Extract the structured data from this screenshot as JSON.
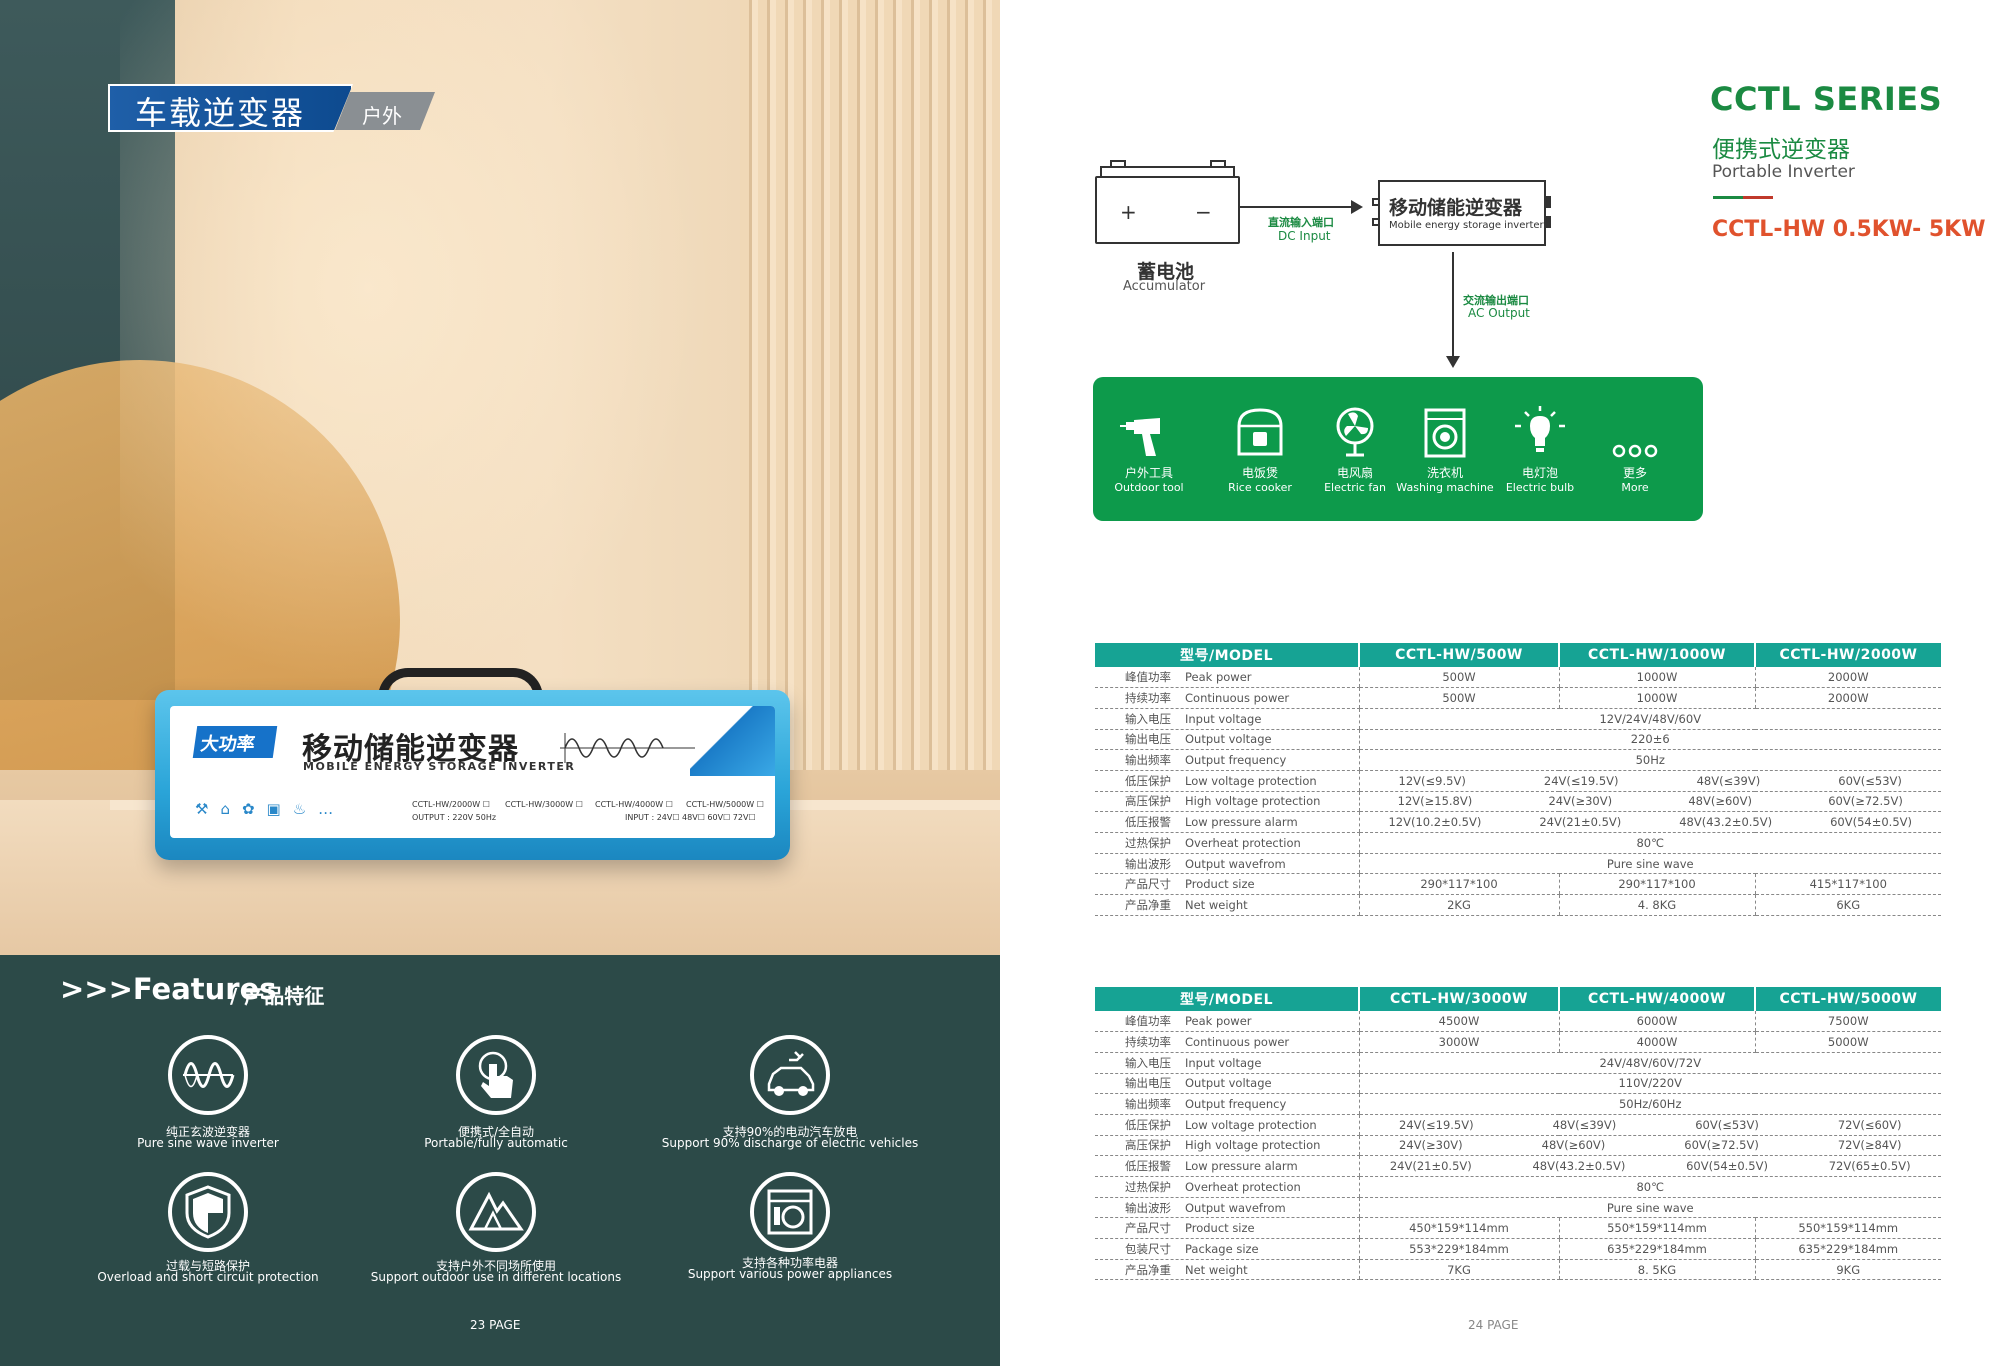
{
  "left": {
    "banner": {
      "title": "车载逆变器",
      "tag": "户外"
    },
    "product": {
      "logo": "大功率",
      "name": "移动储能逆变器",
      "sub": "MOBILE ENERGY STORAGE INVERTER",
      "models": [
        "CCTL-HW/2000W ☐",
        "OUTPUT : 220V 50Hz",
        "CCTL-HW/3000W ☐",
        "CCTL-HW/4000W ☐",
        "INPUT : 24V☐ 48V☐ 60V☐ 72V☐",
        "CCTL-HW/5000W ☐"
      ]
    },
    "features": {
      "title": ">>>Features",
      "title_cn": "/ 产品特征",
      "items": [
        {
          "cn": "纯正玄波逆变器",
          "en": "Pure sine wave inverter",
          "icon": "sine-wave-icon"
        },
        {
          "cn": "便携式/全自动",
          "en": "Portable/fully automatic",
          "icon": "touch-hand-icon"
        },
        {
          "cn": "支持90%的电动汽车放电",
          "en": "Support 90% discharge of electric vehicles",
          "icon": "electric-car-icon"
        },
        {
          "cn": "过载与短路保护",
          "en": "Overload and short circuit protection",
          "icon": "shield-icon"
        },
        {
          "cn": "支持户外不同场所使用",
          "en": "Support outdoor use in different locations",
          "icon": "mountain-icon"
        },
        {
          "cn": "支持各种功率电器",
          "en": "Support various power appliances",
          "icon": "appliance-icon"
        }
      ]
    },
    "page": "23 PAGE"
  },
  "right": {
    "series": "CCTL SERIES",
    "series_cn": "便携式逆变器",
    "series_en": "Portable Inverter",
    "model_range": "CCTL-HW 0.5KW- 5KW",
    "diagram": {
      "battery_cn": "蓄电池",
      "battery_en": "Accumulator",
      "dc_cn": "直流输入端口",
      "dc_en": "DC Input",
      "inverter_cn": "移动储能逆变器",
      "inverter_en": "Mobile energy storage inverter",
      "ac_cn": "交流输出端口",
      "ac_en": "AC Output",
      "apps": [
        {
          "cn": "户外工具",
          "en": "Outdoor tool",
          "icon": "drill-icon"
        },
        {
          "cn": "电饭煲",
          "en": "Rice cooker",
          "icon": "rice-cooker-icon"
        },
        {
          "cn": "电风扇",
          "en": "Electric fan",
          "icon": "fan-icon"
        },
        {
          "cn": "洗衣机",
          "en": "Washing machine",
          "icon": "washing-machine-icon"
        },
        {
          "cn": "电灯泡",
          "en": "Electric bulb",
          "icon": "bulb-icon"
        },
        {
          "cn": "更多",
          "en": "More",
          "icon": "more-icon"
        }
      ]
    },
    "table1": {
      "headers": [
        "型号/MODEL",
        "CCTL-HW/500W",
        "CCTL-HW/1000W",
        "CCTL-HW/2000W"
      ],
      "rows": {
        "peak": [
          "峰值功率",
          "Peak power",
          "500W",
          "1000W",
          "2000W"
        ],
        "cont": [
          "持续功率",
          "Continuous power",
          "500W",
          "1000W",
          "2000W"
        ],
        "input": [
          "输入电压",
          "Input voltage",
          "12V/24V/48V/60V"
        ],
        "output": [
          "输出电压",
          "Output voltage",
          "220±6"
        ],
        "freq": [
          "输出频率",
          "Output frequency",
          "50Hz"
        ],
        "lowv": [
          "低压保护",
          "Low voltage protection",
          "12V(≤9.5V)",
          "24V(≤19.5V)",
          "48V(≤39V)",
          "60V(≤53V)"
        ],
        "highv": [
          "高压保护",
          "High voltage protection",
          "12V(≥15.8V)",
          "24V(≥30V)",
          "48V(≥60V)",
          "60V(≥72.5V)"
        ],
        "alarm": [
          "低压报警",
          "Low pressure alarm",
          "12V(10.2±0.5V)",
          "24V(21±0.5V)",
          "48V(43.2±0.5V)",
          "60V(54±0.5V)"
        ],
        "heat": [
          "过热保护",
          "Overheat protection",
          "80℃"
        ],
        "wave": [
          "输出波形",
          "Output wavefrom",
          "Pure sine wave"
        ],
        "size": [
          "产品尺寸",
          "Product size",
          "290*117*100",
          "290*117*100",
          "415*117*100"
        ],
        "weight": [
          "产品净重",
          "Net weight",
          "2KG",
          "4. 8KG",
          "6KG"
        ]
      }
    },
    "table2": {
      "headers": [
        "型号/MODEL",
        "CCTL-HW/3000W",
        "CCTL-HW/4000W",
        "CCTL-HW/5000W"
      ],
      "rows": {
        "peak": [
          "峰值功率",
          "Peak power",
          "4500W",
          "6000W",
          "7500W"
        ],
        "cont": [
          "持续功率",
          "Continuous power",
          "3000W",
          "4000W",
          "5000W"
        ],
        "input": [
          "输入电压",
          "Input voltage",
          "24V/48V/60V/72V"
        ],
        "output": [
          "输出电压",
          "Output voltage",
          "110V/220V"
        ],
        "freq": [
          "输出频率",
          "Output frequency",
          "50Hz/60Hz"
        ],
        "lowv": [
          "低压保护",
          "Low voltage protection",
          "24V(≤19.5V)",
          "48V(≤39V)",
          "60V(≤53V)",
          "72V(≤60V)"
        ],
        "highv": [
          "高压保护",
          "High voltage protection",
          "24V(≥30V)",
          "48V(≥60V)",
          "60V(≥72.5V)",
          "72V(≥84V)"
        ],
        "alarm": [
          "低压报警",
          "Low pressure alarm",
          "24V(21±0.5V)",
          "48V(43.2±0.5V)",
          "60V(54±0.5V)",
          "72V(65±0.5V)"
        ],
        "heat": [
          "过热保护",
          "Overheat protection",
          "80℃"
        ],
        "wave": [
          "输出波形",
          "Output wavefrom",
          "Pure sine wave"
        ],
        "size": [
          "产品尺寸",
          "Product size",
          "450*159*114mm",
          "550*159*114mm",
          "550*159*114mm"
        ],
        "pack": [
          "包装尺寸",
          "Package size",
          "553*229*184mm",
          "635*229*184mm",
          "635*229*184mm"
        ],
        "weight": [
          "产品净重",
          "Net weight",
          "7KG",
          "8. 5KG",
          "9KG"
        ]
      }
    },
    "page": "24 PAGE"
  }
}
